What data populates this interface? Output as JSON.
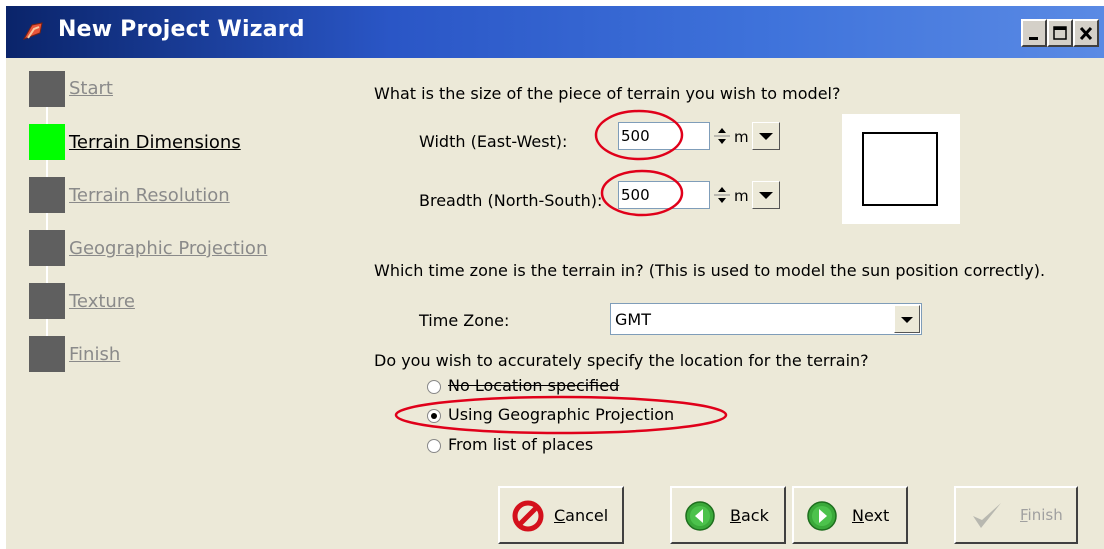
{
  "window": {
    "title": "New Project Wizard",
    "controls": {
      "minimize": "minimize-icon",
      "maximize": "maximize-icon",
      "close": "close-icon"
    }
  },
  "steps": [
    {
      "label": "Start",
      "state": "done"
    },
    {
      "label": "Terrain Dimensions",
      "state": "current"
    },
    {
      "label": "Terrain Resolution",
      "state": "pending"
    },
    {
      "label": "Geographic Projection",
      "state": "pending"
    },
    {
      "label": "Texture",
      "state": "pending"
    },
    {
      "label": "Finish",
      "state": "pending"
    }
  ],
  "size": {
    "question": "What is the size of the piece of terrain you wish to model?",
    "width_label": "Width (East-West):",
    "width_value": "500",
    "width_unit": "m",
    "breadth_label": "Breadth (North-South):",
    "breadth_value": "500",
    "breadth_unit": "m"
  },
  "timezone": {
    "question": "Which time zone is the terrain in? (This is used to model the sun position correctly).",
    "label": "Time Zone:",
    "value": "GMT"
  },
  "location": {
    "question": "Do you wish to accurately specify the location for the terrain?",
    "options": [
      {
        "label": "No Location specified",
        "selected": false
      },
      {
        "label": "Using Geographic Projection",
        "selected": true
      },
      {
        "label": "From list of places",
        "selected": false
      }
    ]
  },
  "buttons": {
    "cancel": {
      "mnemonic": "C",
      "rest": "ancel"
    },
    "back": {
      "mnemonic": "B",
      "rest": "ack"
    },
    "next": {
      "mnemonic": "N",
      "rest": "ext"
    },
    "finish": {
      "mnemonic": "F",
      "rest": "inish",
      "enabled": false
    }
  },
  "colors": {
    "titlebar": "#0a246a",
    "active_step": "#00ff00",
    "inactive_step": "#5f5f5f",
    "annotation": "#e0001a"
  }
}
